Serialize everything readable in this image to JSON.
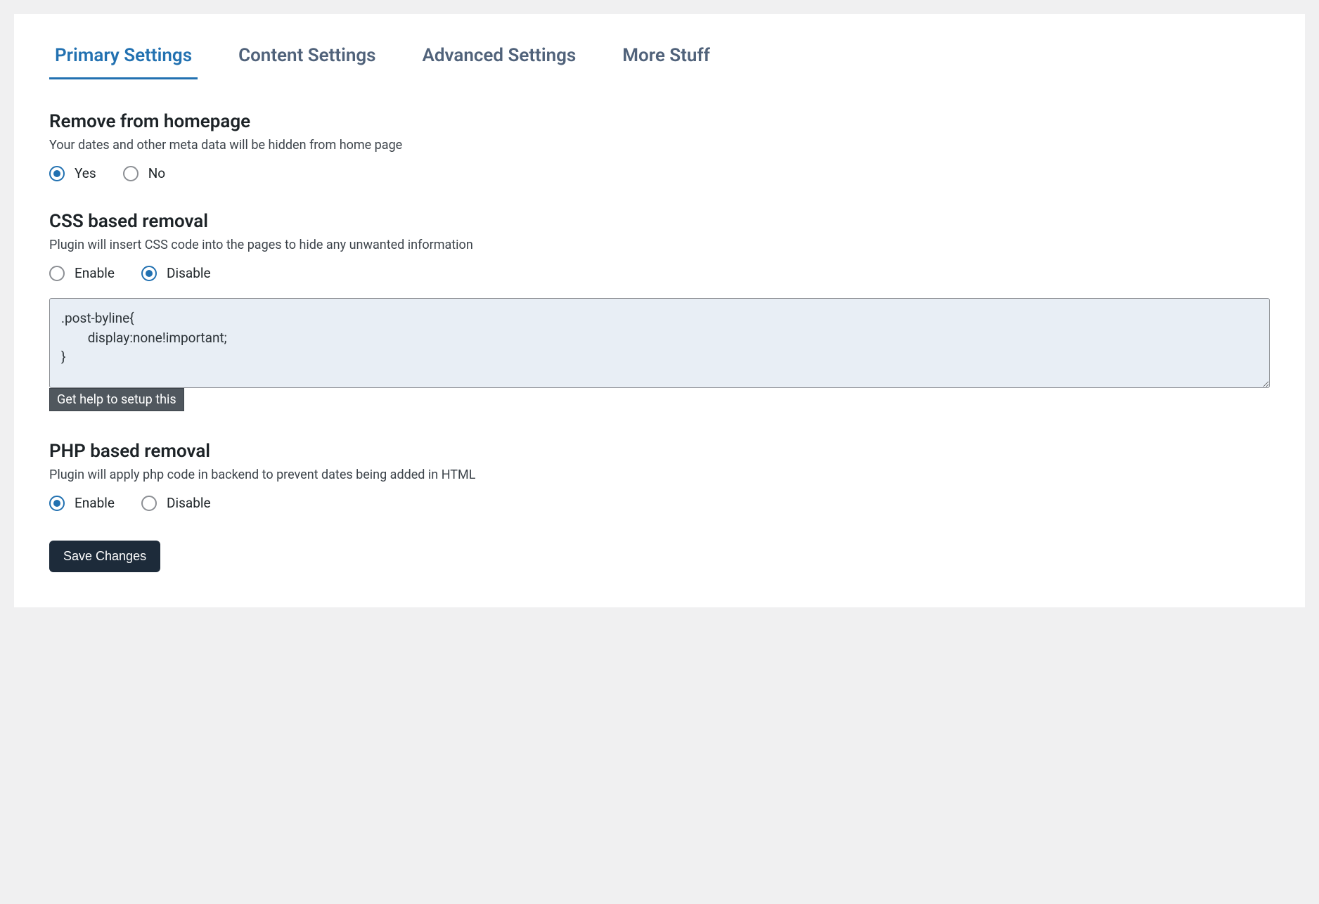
{
  "tabs": [
    {
      "label": "Primary Settings",
      "active": true
    },
    {
      "label": "Content Settings",
      "active": false
    },
    {
      "label": "Advanced Settings",
      "active": false
    },
    {
      "label": "More Stuff",
      "active": false
    }
  ],
  "sections": {
    "remove_home": {
      "title": "Remove from homepage",
      "desc": "Your dates and other meta data will be hidden from home page",
      "options": {
        "yes": "Yes",
        "no": "No"
      },
      "selected": "yes"
    },
    "css_removal": {
      "title": "CSS based removal",
      "desc": "Plugin will insert CSS code into the pages to hide any unwanted information",
      "options": {
        "enable": "Enable",
        "disable": "Disable"
      },
      "selected": "disable",
      "css_value": ".post-byline{\n        display:none!important;\n}",
      "help_label": "Get help to setup this"
    },
    "php_removal": {
      "title": "PHP based removal",
      "desc": "Plugin will apply php code in backend to prevent dates being added in HTML",
      "options": {
        "enable": "Enable",
        "disable": "Disable"
      },
      "selected": "enable"
    }
  },
  "save_label": "Save Changes"
}
